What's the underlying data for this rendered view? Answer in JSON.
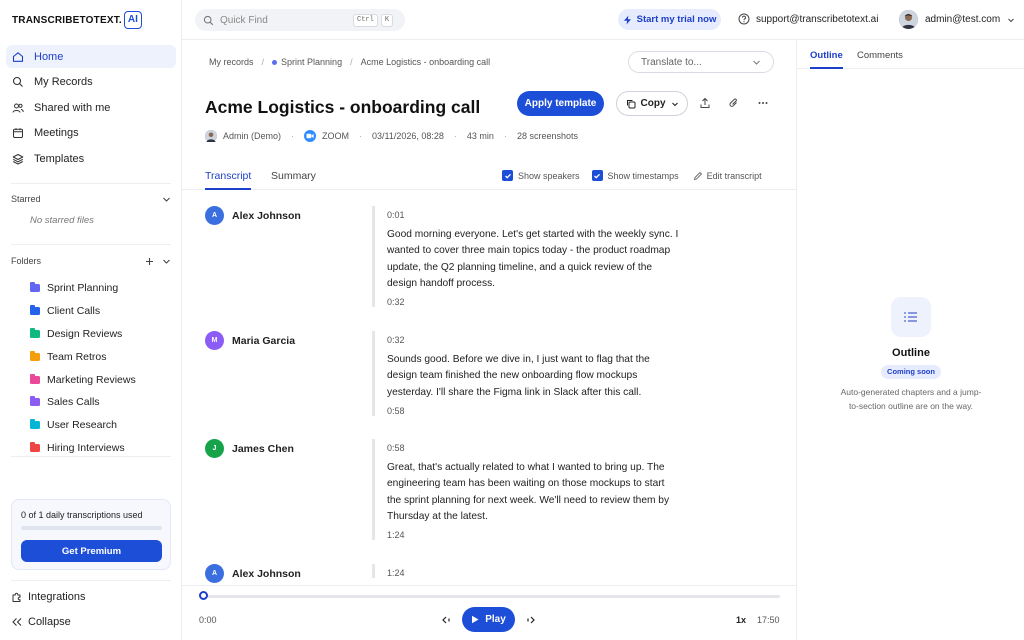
{
  "brand": {
    "logo_text": "TRANSCRIBETOTEXT.",
    "logo_suffix": "AI"
  },
  "sidebar": {
    "nav": [
      {
        "label": "Home",
        "icon": "home-icon",
        "active": true
      },
      {
        "label": "My Records",
        "icon": "search-icon",
        "active": false
      },
      {
        "label": "Shared with me",
        "icon": "users-icon",
        "active": false
      },
      {
        "label": "Meetings",
        "icon": "calendar-icon",
        "active": false
      },
      {
        "label": "Templates",
        "icon": "layers-icon",
        "active": false
      }
    ],
    "starred_label": "Starred",
    "no_starred": "No starred files",
    "folders_label": "Folders",
    "folders": [
      {
        "label": "Sprint Planning",
        "color": "#6366f1"
      },
      {
        "label": "Client Calls",
        "color": "#2563eb"
      },
      {
        "label": "Design Reviews",
        "color": "#10b981"
      },
      {
        "label": "Team Retros",
        "color": "#f59e0b"
      },
      {
        "label": "Marketing Reviews",
        "color": "#ec4899"
      },
      {
        "label": "Sales Calls",
        "color": "#8b5cf6"
      },
      {
        "label": "User Research",
        "color": "#06b6d4"
      },
      {
        "label": "Hiring Interviews",
        "color": "#ef4444"
      }
    ],
    "usage_text": "0 of 1 daily transcriptions used",
    "usage_fraction": 0,
    "premium_label": "Get Premium",
    "integrations_label": "Integrations",
    "collapse_label": "Collapse"
  },
  "topbar": {
    "search_placeholder": "Quick Find",
    "shortcut_keys": [
      "Ctrl",
      "K"
    ],
    "trial_label": "Start my trial now",
    "support_email": "support@transcribetotext.ai",
    "user_email": "admin@test.com"
  },
  "record": {
    "breadcrumbs": [
      "My records",
      "Sprint Planning",
      "Acme Logistics - onboarding call"
    ],
    "translate_placeholder": "Translate to...",
    "title": "Acme Logistics - onboarding call",
    "apply_template_label": "Apply template",
    "copy_label": "Copy",
    "meta": {
      "owner": "Admin (Demo)",
      "source": "ZOOM",
      "datetime": "03/11/2026, 08:28",
      "duration": "43 min",
      "screenshots": "28 screenshots"
    },
    "tabs": [
      "Transcript",
      "Summary"
    ],
    "show_speakers_label": "Show speakers",
    "show_timestamps_label": "Show timestamps",
    "edit_transcript_label": "Edit transcript"
  },
  "transcript": [
    {
      "speaker": "Alex Johnson",
      "initial": "A",
      "color": "#3b6fe0",
      "start": "0:01",
      "end": "0:32",
      "lines": [
        "Good morning everyone. Let's get started with the weekly sync. I",
        "wanted to cover three main topics today - the product roadmap",
        "update, the Q2 planning timeline, and a quick review of the",
        "design handoff process."
      ]
    },
    {
      "speaker": "Maria Garcia",
      "initial": "M",
      "color": "#8b5cf6",
      "start": "0:32",
      "end": "0:58",
      "lines": [
        "Sounds good. Before we dive in, I just want to flag that the",
        "design team finished the new onboarding flow mockups",
        "yesterday. I'll share the Figma link in Slack after this call."
      ]
    },
    {
      "speaker": "James Chen",
      "initial": "J",
      "color": "#16a34a",
      "start": "0:58",
      "end": "1:24",
      "lines": [
        "Great, that's actually related to what I wanted to bring up. The",
        "engineering team has been waiting on those mockups to start",
        "the sprint planning for next week. We'll need to review them by",
        "Thursday at the latest."
      ]
    },
    {
      "speaker": "Alex Johnson",
      "initial": "A",
      "color": "#3b6fe0",
      "start": "1:24",
      "end": "",
      "lines": []
    }
  ],
  "player": {
    "current_time": "0:00",
    "total_time": "17:50",
    "play_label": "Play",
    "speed": "1x",
    "progress_fraction": 0
  },
  "right_panel": {
    "tabs": [
      "Outline",
      "Comments"
    ],
    "title": "Outline",
    "badge": "Coming soon",
    "description_lines": [
      "Auto-generated chapters and a jump-",
      "to-section outline are on the way."
    ]
  }
}
